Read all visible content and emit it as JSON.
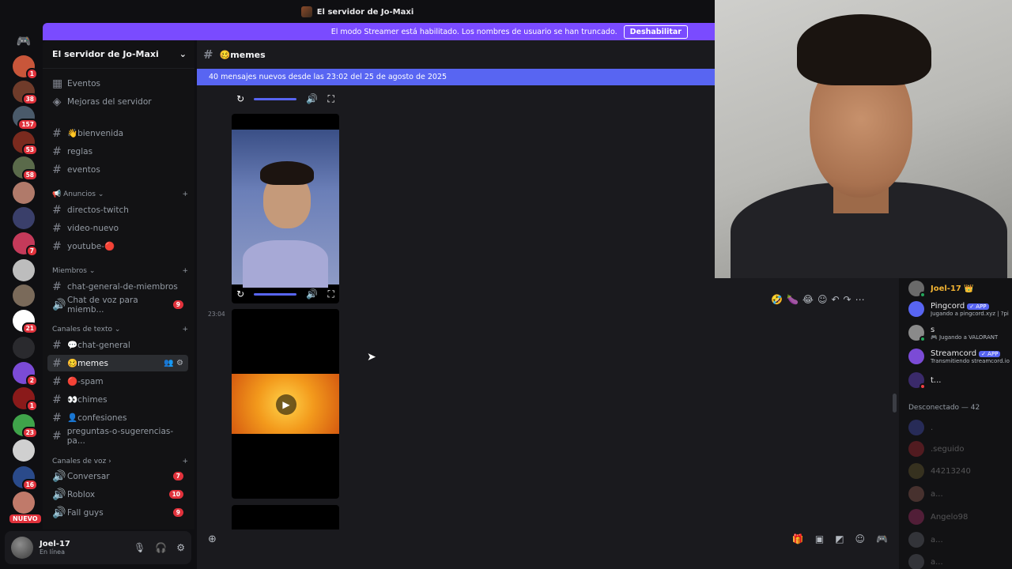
{
  "titlebar": {
    "server_title": "El servidor de Jo-Maxi"
  },
  "streamer_banner": {
    "text": "El modo Streamer está habilitado. Los nombres de usuario se han truncado.",
    "button": "Deshabilitar"
  },
  "guild_rail": {
    "badges": [
      "1",
      "38",
      "157",
      "53",
      "58",
      "7",
      "21",
      "2",
      "1",
      "23",
      "16"
    ],
    "new_label": "NUEVO"
  },
  "server": {
    "name": "El servidor de Jo-Maxi",
    "top_items": [
      "Eventos",
      "Mejoras del servidor"
    ],
    "channels": {
      "c1": "👋bienvenida",
      "c2": "reglas",
      "c3": "eventos",
      "cat_anuncios": "📢 Anuncios",
      "c4": "directos-twitch",
      "c5": "video-nuevo",
      "c6": "youtube-🔴",
      "cat_miembros": "Miembros",
      "c7": "chat-general-de-miembros",
      "c8": "Chat de voz para miemb...",
      "c8_badge": "9",
      "cat_texto": "Canales de texto",
      "c9": "💬chat-general",
      "c10": "🥴memes",
      "c11": "🔴-spam",
      "c12": "👀chimes",
      "c13": "👤confesiones",
      "c14": "preguntas-o-sugerencias-pa...",
      "cat_voz": "Canales de voz",
      "c15": "Conversar",
      "c15_badge": "7",
      "c16": "Roblox",
      "c16_badge": "10",
      "c17": "Fall guys",
      "c17_badge": "9"
    }
  },
  "user": {
    "name": "Joel-17",
    "status": "En línea"
  },
  "chat": {
    "channel_title": "🥴memes",
    "new_messages": "40 mensajes nuevos desde las 23:02 del 25 de agosto de 2025",
    "timestamp": "23:04"
  },
  "members": {
    "online": [
      {
        "name": "Joel-17 👑",
        "sub": "",
        "color": "#f0b232"
      },
      {
        "name": "Pingcord",
        "app": "✓ APP",
        "sub": "Jugando a pingcord.xyz | ?pi"
      },
      {
        "name": "s",
        "sub": "🎮 Jugando a VALORANT"
      },
      {
        "name": "Streamcord",
        "app": "✓ APP",
        "sub": "Transmitiendo streamcord.io"
      },
      {
        "name": "t...",
        "sub": ""
      }
    ],
    "offline_header": "Desconectado — 42",
    "offline": [
      ".",
      ".seguido",
      "44213240",
      "a...",
      "Angelo98",
      "a...",
      "a..."
    ]
  }
}
